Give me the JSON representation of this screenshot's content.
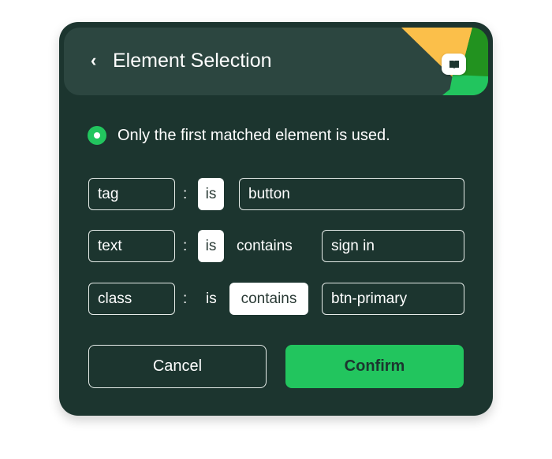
{
  "header": {
    "back_icon": "chevron-left-icon",
    "title": "Element Selection",
    "guide_icon": "book-open-icon"
  },
  "note": {
    "icon": "radio-selected-icon",
    "text": "Only the first matched element is used."
  },
  "rules": [
    {
      "attribute": "tag",
      "separator": ":",
      "operators": [
        {
          "label": "is",
          "selected": true
        }
      ],
      "value": "button"
    },
    {
      "attribute": "text",
      "separator": ":",
      "operators": [
        {
          "label": "is",
          "selected": true
        },
        {
          "label": "contains",
          "selected": false
        }
      ],
      "value": "sign in"
    },
    {
      "attribute": "class",
      "separator": ":",
      "operators": [
        {
          "label": "is",
          "selected": false
        },
        {
          "label": "contains",
          "selected": true
        }
      ],
      "value": "btn-primary"
    }
  ],
  "actions": {
    "cancel_label": "Cancel",
    "confirm_label": "Confirm"
  },
  "colors": {
    "card_bg": "#1c352f",
    "header_bg": "#2c4640",
    "accent_green": "#22c55e",
    "corner_yellow": "#fbbf4a",
    "corner_dark_green": "#22921f"
  }
}
